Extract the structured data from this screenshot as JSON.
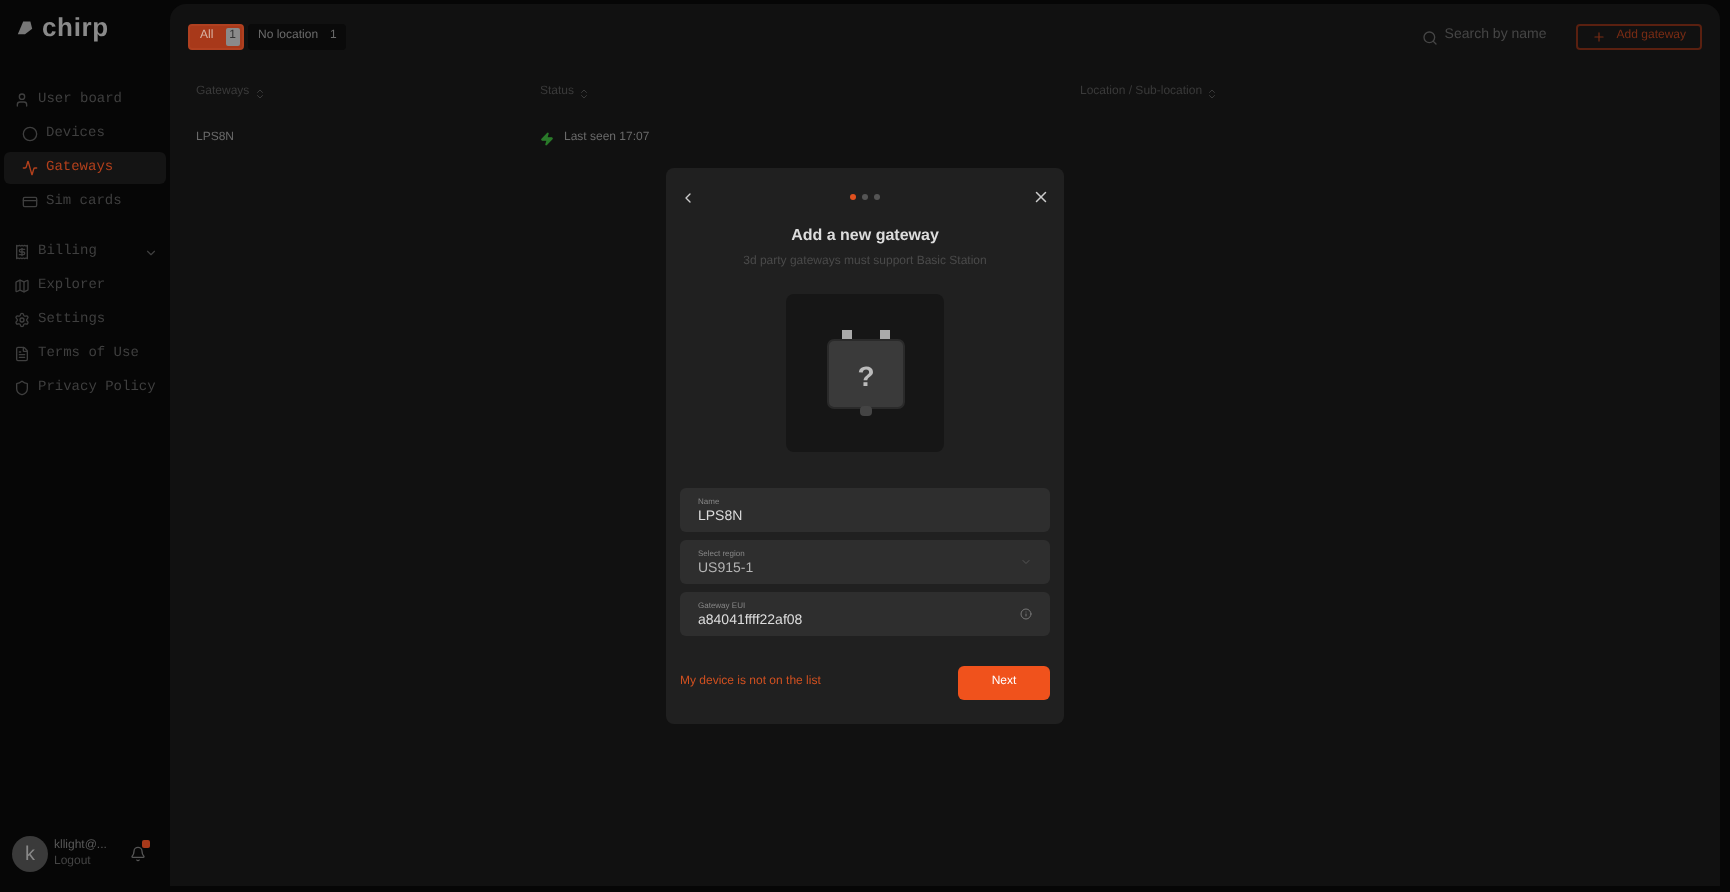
{
  "sidebar": {
    "logo": "chirp",
    "items": [
      {
        "label": "User board",
        "selected": false,
        "kind": "link"
      },
      {
        "label": "Devices",
        "selected": false,
        "kind": "sub"
      },
      {
        "label": "Gateways",
        "selected": true,
        "kind": "sub"
      },
      {
        "label": "Sim cards",
        "selected": false,
        "kind": "sub"
      },
      {
        "label": "Billing",
        "selected": false,
        "kind": "group"
      },
      {
        "label": "Explorer",
        "selected": false,
        "kind": "link"
      },
      {
        "label": "Settings",
        "selected": false,
        "kind": "link"
      },
      {
        "label": "Terms of Use",
        "selected": false,
        "kind": "link"
      },
      {
        "label": "Privacy Policy",
        "selected": false,
        "kind": "link"
      }
    ],
    "user": {
      "initial": "k",
      "name": "kllight@...",
      "action": "Logout",
      "notification": true
    }
  },
  "filters": [
    {
      "label": "All",
      "count": "1",
      "selected": true
    },
    {
      "label": "No location",
      "count": "1",
      "selected": false
    }
  ],
  "search": {
    "placeholder": "Search by name"
  },
  "add_button": "Add gateway",
  "table": {
    "columns": [
      "Gateways",
      "Status",
      "Location / Sub-location"
    ],
    "rows": [
      {
        "gateway": "LPS8N",
        "status": "Last seen 17:07"
      }
    ]
  },
  "modal": {
    "steps": [
      {
        "selected": true
      },
      {
        "selected": false
      },
      {
        "selected": false
      }
    ],
    "title": "Add a new gateway",
    "subtitle": "3d party gateways must support Basic Station",
    "device_mark": "?",
    "fields": [
      {
        "kind": "text",
        "label": "Name",
        "value": "LPS8N"
      },
      {
        "kind": "select",
        "label": "Select region",
        "value": "US915-1"
      },
      {
        "kind": "info",
        "label": "Gateway EUI",
        "value": "a84041ffff22af08"
      }
    ],
    "link": "My device is not on the list",
    "next": "Next"
  }
}
